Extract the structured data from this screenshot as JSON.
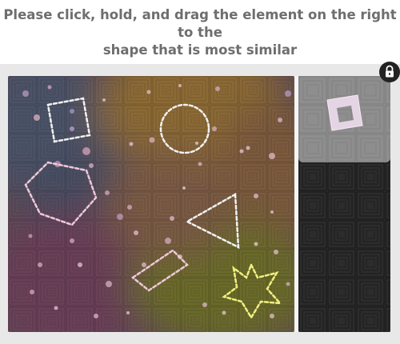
{
  "instruction": {
    "line1": "Please click, hold, and drag the element on the right to the",
    "line2": "shape that is most similar"
  },
  "icons": {
    "lock": "lock-icon"
  },
  "colors": {
    "panel_bg": "#e8e8e8",
    "piece_panel_bg": "#2a2a2a",
    "piece_card_bg": "#8e8e8e",
    "piece_square": "#e4d4e4",
    "outline_white": "#f2f2f2",
    "outline_pink": "#f0c8d8",
    "outline_yellow": "#f0f080"
  }
}
